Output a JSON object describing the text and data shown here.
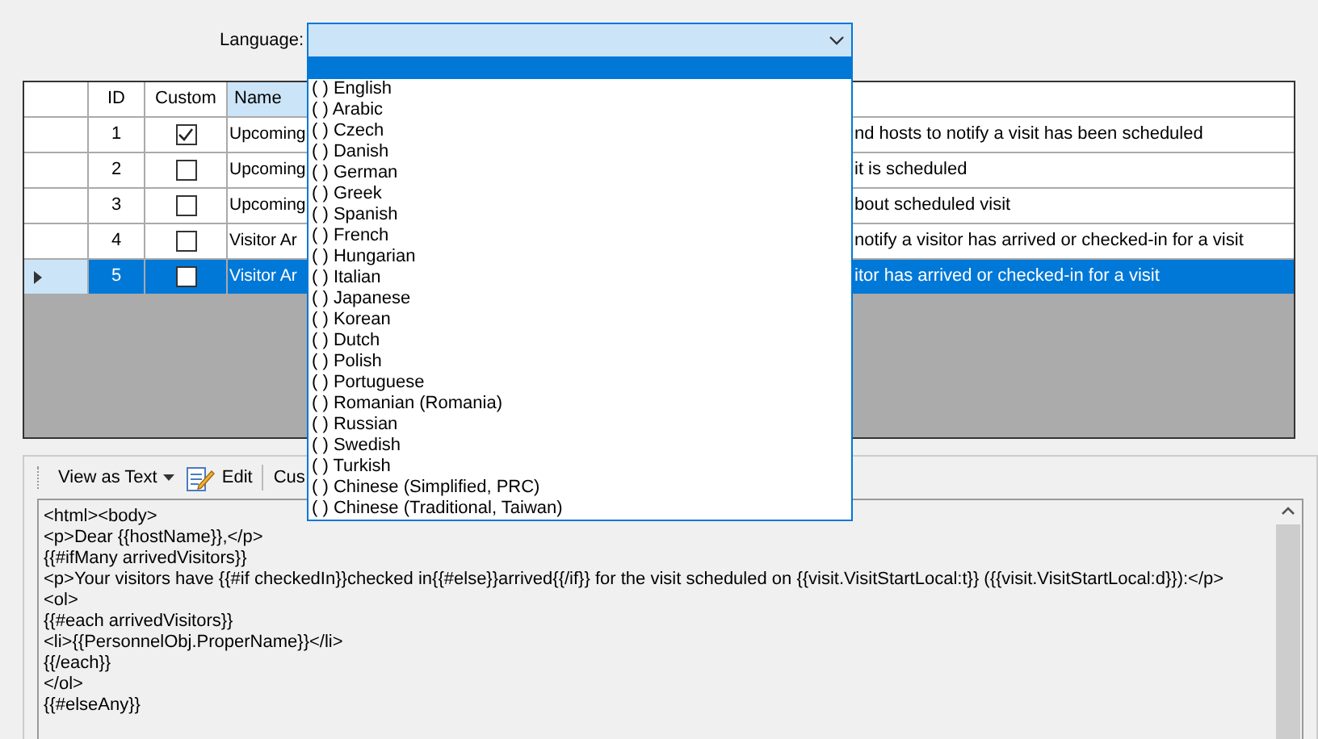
{
  "language": {
    "label": "Language:",
    "expanded": true,
    "options": [
      {
        "label": "( ) English",
        "selected": false
      },
      {
        "label": "( ) Arabic",
        "selected": false
      },
      {
        "label": "( ) Czech",
        "selected": false
      },
      {
        "label": "( ) Danish",
        "selected": false
      },
      {
        "label": "( ) German",
        "selected": false
      },
      {
        "label": "( ) Greek",
        "selected": false
      },
      {
        "label": "( ) Spanish",
        "selected": false
      },
      {
        "label": "( ) French",
        "selected": false
      },
      {
        "label": "( ) Hungarian",
        "selected": false
      },
      {
        "label": "( ) Italian",
        "selected": false
      },
      {
        "label": "( ) Japanese",
        "selected": false
      },
      {
        "label": "( ) Korean",
        "selected": false
      },
      {
        "label": "( ) Dutch",
        "selected": false
      },
      {
        "label": "( ) Polish",
        "selected": false
      },
      {
        "label": "( ) Portuguese",
        "selected": false
      },
      {
        "label": "( ) Romanian (Romania)",
        "selected": false
      },
      {
        "label": "( ) Russian",
        "selected": false
      },
      {
        "label": "( ) Swedish",
        "selected": false
      },
      {
        "label": "( ) Turkish",
        "selected": false
      },
      {
        "label": "( ) Chinese (Simplified, PRC)",
        "selected": false
      },
      {
        "label": "( ) Chinese (Traditional, Taiwan)",
        "selected": false
      }
    ]
  },
  "table": {
    "columns": [
      {
        "label": "ID",
        "selected": false
      },
      {
        "label": "Custom",
        "selected": false
      },
      {
        "label": "Name",
        "selected": true
      }
    ],
    "rows": [
      {
        "id": "1",
        "checked": true,
        "name": "Upcoming",
        "column_4": "nd hosts to notify a visit has been scheduled",
        "selected": false
      },
      {
        "id": "2",
        "checked": false,
        "name": "Upcoming",
        "column_4": "it is scheduled",
        "selected": false
      },
      {
        "id": "3",
        "checked": false,
        "name": "Upcoming",
        "column_4": "bout scheduled visit",
        "selected": false
      },
      {
        "id": "4",
        "checked": false,
        "name": "Visitor Ar",
        "column_4": "notify a visitor has arrived or checked-in for a visit",
        "selected": false
      },
      {
        "id": "5",
        "checked": false,
        "name": "Visitor Ar",
        "column_4": "itor has arrived or checked-in for a visit",
        "selected": true
      }
    ]
  },
  "toolbar": {
    "view": "View as Text",
    "edit": "Edit",
    "custom": "Cus"
  },
  "code_lines": [
    "<html><body>",
    "<p>Dear {{hostName}},</p>",
    "{{#ifMany arrivedVisitors}}",
    "<p>Your visitors have {{#if checkedIn}}checked in{{#else}}arrived{{/if}} for the visit scheduled on {{visit.VisitStartLocal:t}} ({{visit.VisitStartLocal:d}}):</p>",
    "<ol>",
    "{{#each arrivedVisitors}}",
    "<li>{{PersonnelObj.ProperName}}</li>",
    "{{/each}}",
    "</ol>",
    "{{#elseAny}}"
  ]
}
